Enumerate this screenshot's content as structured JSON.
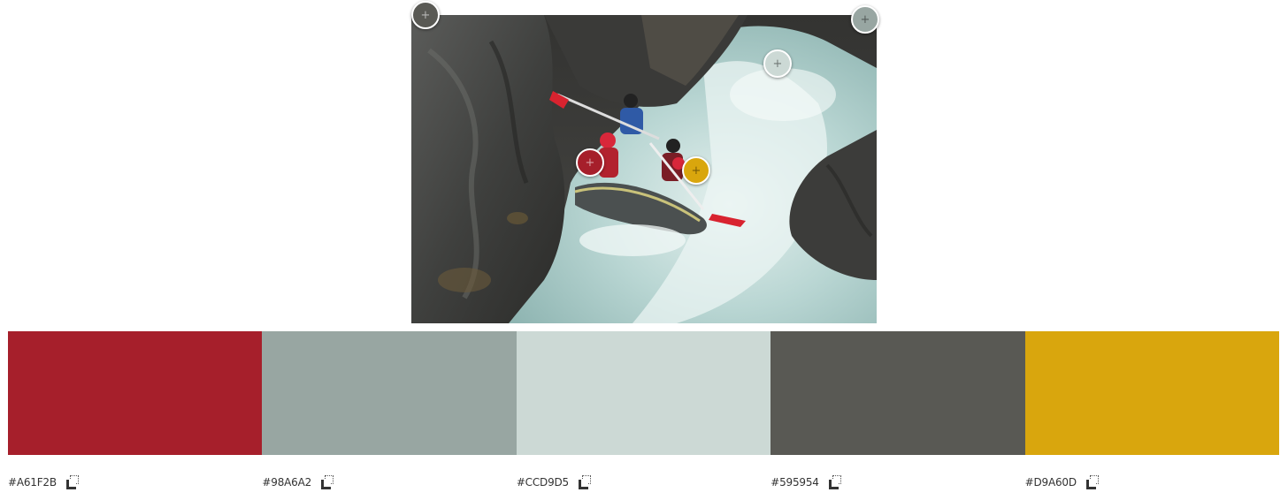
{
  "photo": {
    "subject": "whitewater-rafting-photo"
  },
  "markers": [
    {
      "id": "marker-dark-gray",
      "color": "#595954",
      "icon": "plus-icon",
      "symbol": "+"
    },
    {
      "id": "marker-gray",
      "color": "#98A6A2",
      "icon": "plus-icon",
      "symbol": "+"
    },
    {
      "id": "marker-light-gray",
      "color": "#CCD9D5",
      "icon": "plus-icon",
      "symbol": "+"
    },
    {
      "id": "marker-red",
      "color": "#A61F2B",
      "icon": "plus-icon",
      "symbol": "+"
    },
    {
      "id": "marker-yellow",
      "color": "#D9A60D",
      "icon": "plus-icon",
      "symbol": "+"
    }
  ],
  "palette": [
    {
      "hex": "#A61F2B",
      "color": "#A61F2B",
      "copy_icon": "copy-icon"
    },
    {
      "hex": "#98A6A2",
      "color": "#98A6A2",
      "copy_icon": "copy-icon"
    },
    {
      "hex": "#CCD9D5",
      "color": "#CCD9D5",
      "copy_icon": "copy-icon"
    },
    {
      "hex": "#595954",
      "color": "#595954",
      "copy_icon": "copy-icon"
    },
    {
      "hex": "#D9A60D",
      "color": "#D9A60D",
      "copy_icon": "copy-icon"
    }
  ]
}
